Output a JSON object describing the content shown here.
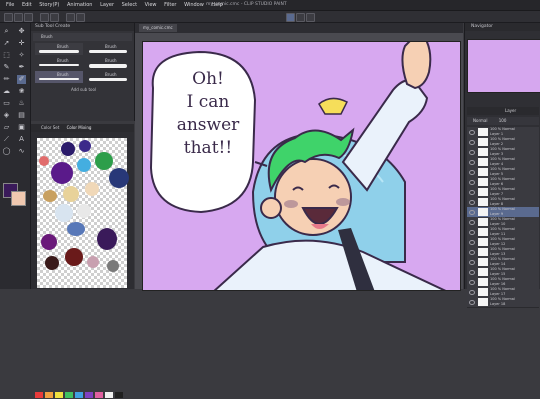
{
  "menu": {
    "items": [
      "File",
      "Edit",
      "Story(P)",
      "Animation",
      "Layer",
      "Select",
      "View",
      "Filter",
      "Window",
      "Help"
    ],
    "title": "my_comic.cmc - CLIP STUDIO PAINT"
  },
  "subtool": {
    "title": "Sub Tool Create",
    "tab": "Brush",
    "brushes": [
      {
        "left": "Brush",
        "right": "Brush"
      },
      {
        "left": "Brush",
        "right": "Brush"
      },
      {
        "left": "Brush",
        "right": "Brush"
      }
    ],
    "add_label": "Add sub tool"
  },
  "color": {
    "tabs": [
      "Color Set",
      "Color Mixing"
    ]
  },
  "canvas": {
    "tab_label": "my_comic.cmc",
    "speech_text": [
      "Oh!",
      "I can",
      "answer",
      "that!!"
    ]
  },
  "navigator": {
    "title": "Navigator"
  },
  "layers": {
    "title": "Layer",
    "mode_tabs": [
      "Normal",
      "100"
    ],
    "rows": [
      {
        "opacity": "100 % Normal",
        "name": "Layer 1"
      },
      {
        "opacity": "100 % Normal",
        "name": "Layer 2"
      },
      {
        "opacity": "100 % Normal",
        "name": "Layer 3"
      },
      {
        "opacity": "100 % Normal",
        "name": "Layer 4"
      },
      {
        "opacity": "100 % Normal",
        "name": "Layer 5"
      },
      {
        "opacity": "100 % Normal",
        "name": "Layer 6"
      },
      {
        "opacity": "100 % Normal",
        "name": "Layer 7"
      },
      {
        "opacity": "100 % Normal",
        "name": "Layer 8"
      },
      {
        "opacity": "100 % Normal",
        "name": "Layer 9"
      },
      {
        "opacity": "100 % Normal",
        "name": "Layer 10"
      },
      {
        "opacity": "100 % Normal",
        "name": "Layer 11"
      },
      {
        "opacity": "100 % Normal",
        "name": "Layer 12"
      },
      {
        "opacity": "100 % Normal",
        "name": "Layer 13"
      },
      {
        "opacity": "100 % Normal",
        "name": "Layer 14"
      },
      {
        "opacity": "100 % Normal",
        "name": "Layer 15"
      },
      {
        "opacity": "100 % Normal",
        "name": "Layer 16"
      },
      {
        "opacity": "100 % Normal",
        "name": "Layer 17"
      },
      {
        "opacity": "100 % Normal",
        "name": "Layer 18"
      },
      {
        "opacity": "100 % Normal",
        "name": "Layer 19"
      }
    ]
  },
  "colors": {
    "canvas_bg": "#d7a8f0",
    "ui_dark": "#2f2f34",
    "accent_selected": "#5a6a8f",
    "hair_green": "#3fd36a",
    "jacket_blue": "#8fd0ea"
  }
}
